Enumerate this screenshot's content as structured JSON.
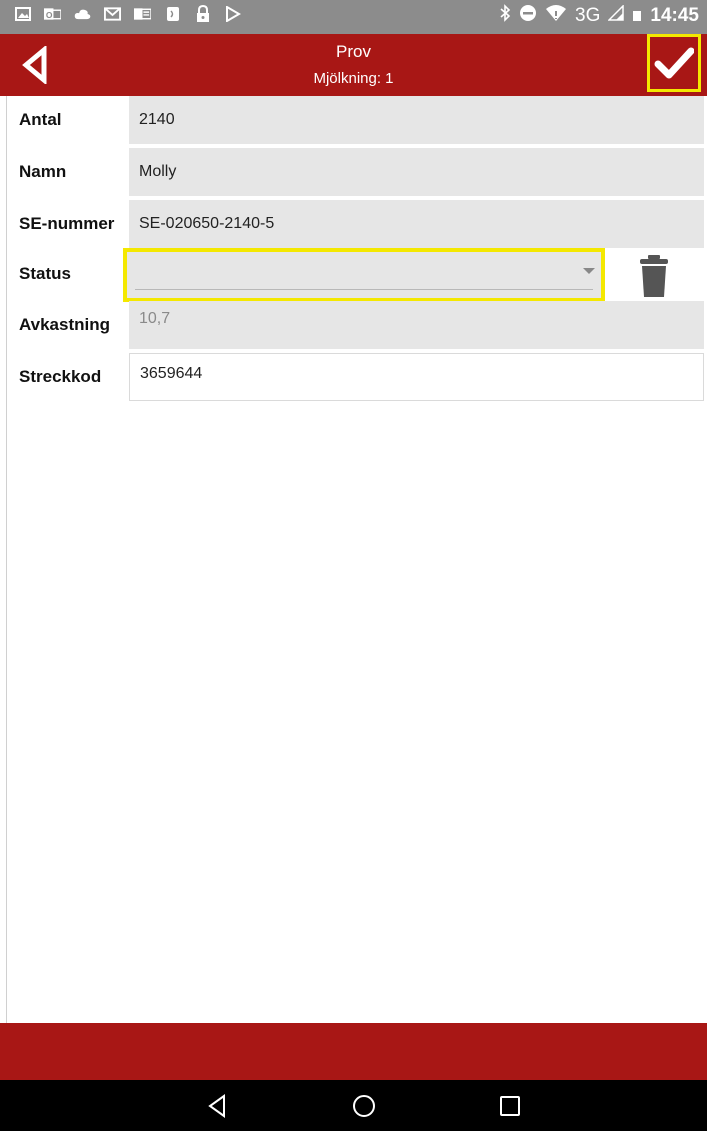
{
  "status_bar": {
    "network": "3G",
    "time": "14:45",
    "notification_icons": [
      "gallery-icon",
      "outlook-icon",
      "cloud-icon",
      "gmail-icon",
      "outlook-calendar-icon",
      "nfc-icon",
      "lock-icon",
      "play-icon"
    ],
    "system_icons": [
      "bluetooth-icon",
      "do-not-disturb-icon",
      "wifi-icon",
      "signal-icon",
      "battery-icon"
    ]
  },
  "header": {
    "title": "Prov",
    "subtitle": "Mjölkning: 1",
    "back_icon": "back-arrow-icon",
    "confirm_icon": "checkmark-icon",
    "color": "#a81715"
  },
  "form": {
    "antal": {
      "label": "Antal",
      "value": "2140"
    },
    "namn": {
      "label": "Namn",
      "value": "Molly"
    },
    "se_nummer": {
      "label": "SE-nummer",
      "value": "SE-020650-2140-5"
    },
    "status": {
      "label": "Status",
      "value": ""
    },
    "avkastning": {
      "label": "Avkastning",
      "value": "10,7"
    },
    "streckkod": {
      "label": "Streckkod",
      "value": "3659644"
    }
  },
  "highlight_color": "#f4e800",
  "nav": {
    "back": "nav-back-icon",
    "home": "nav-home-icon",
    "recents": "nav-recents-icon"
  }
}
